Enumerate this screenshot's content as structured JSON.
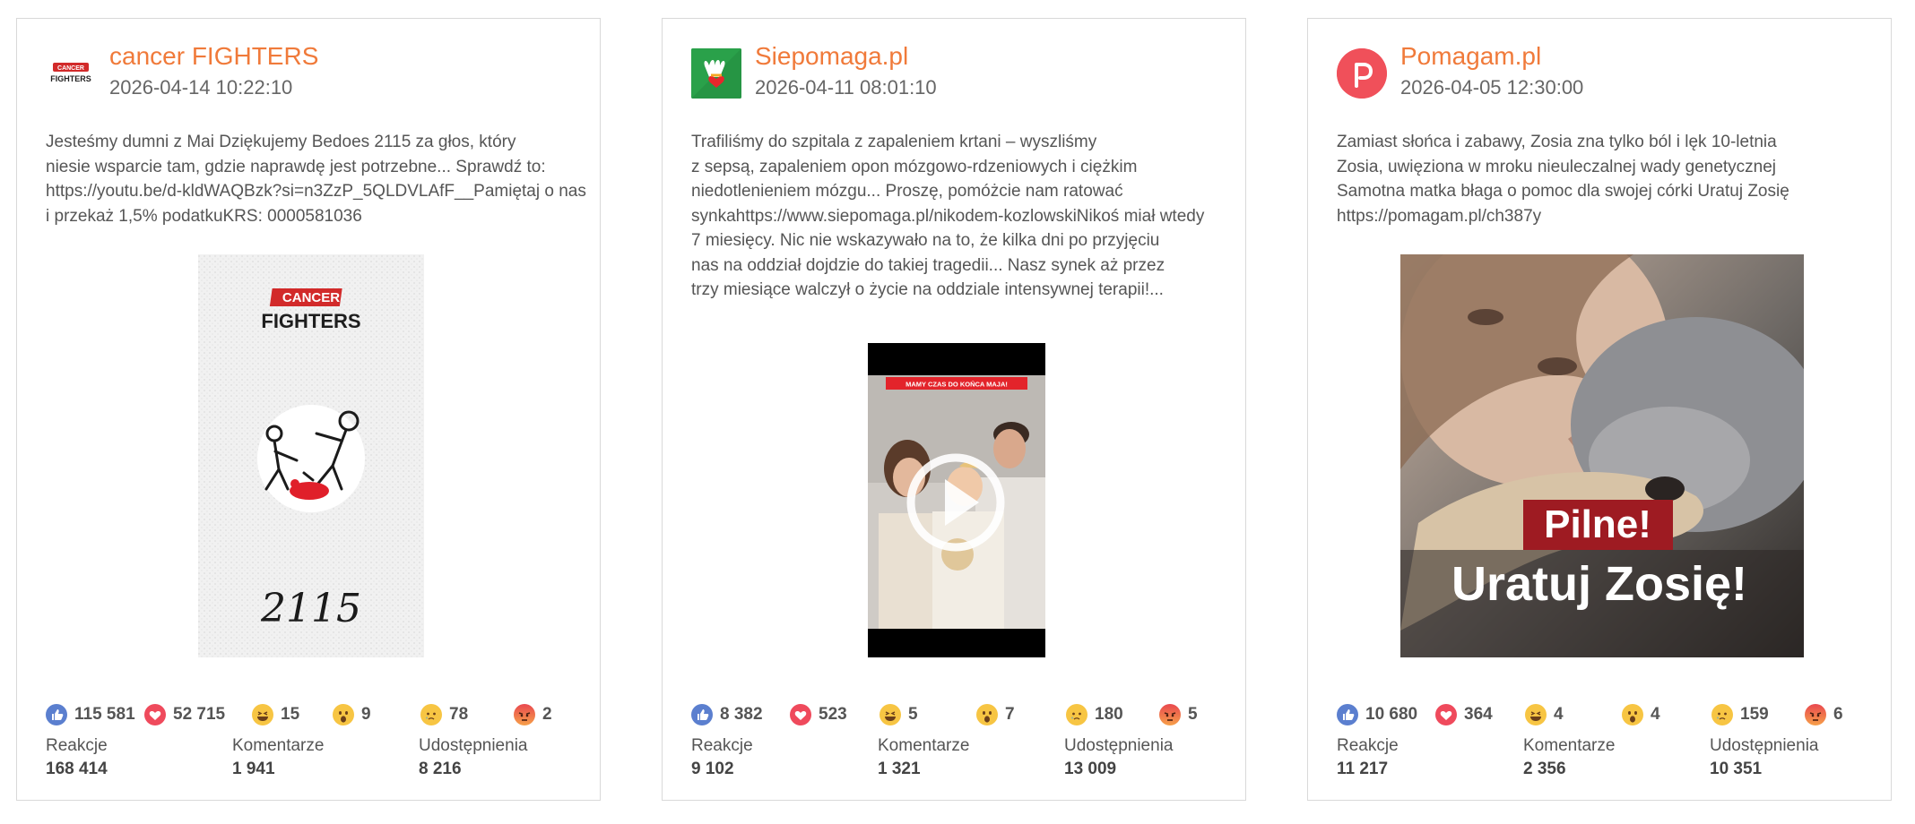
{
  "posts": [
    {
      "page_name": "cancer FIGHTERS",
      "date": "2026-04-14 10:22:10",
      "avatar_text": [
        "CANCER",
        "FIGHTERS"
      ],
      "text_lines": [
        "Jesteśmy dumni z Mai Dziękujemy Bedoes 2115 za głos, który",
        "niesie wsparcie tam, gdzie naprawdę jest potrzebne... Sprawdź to:",
        "https://youtu.be/d-kldWAQBzk?si=n3ZzP_5QLDVLAfF__Pamiętaj o nas",
        "i przekaż 1,5% podatkuKRS: 0000581036"
      ],
      "image_text": {
        "badge": "CANCER",
        "title": "FIGHTERS",
        "number": "2115"
      },
      "reactions": {
        "like": "115 581",
        "love": "52 715",
        "haha": "15",
        "wow": "9",
        "sad": "78",
        "angry": "2"
      },
      "stats": {
        "reactions_label": "Reakcje",
        "reactions": "168 414",
        "comments_label": "Komentarze",
        "comments": "1 941",
        "shares_label": "Udostępnienia",
        "shares": "8 216"
      }
    },
    {
      "page_name": "Siepomaga.pl",
      "date": "2026-04-11 08:01:10",
      "text_lines": [
        "Trafiliśmy do szpitala z zapaleniem krtani – wyszliśmy",
        "z sepsą, zapaleniem opon mózgowo-rdzeniowych i ciężkim",
        "niedotlenieniem mózgu... Proszę, pomóżcie nam ratować",
        "synkahttps://www.siepomaga.pl/nikodem-kozlowskiNikoś miał wtedy",
        "7 miesięcy. Nic nie wskazywało na to, że kilka dni po przyjęciu",
        "nas na oddział dojdzie do takiej tragedii... Nasz synek aż przez",
        "trzy miesiące walczył o życie na oddziale intensywnej terapii!..."
      ],
      "video_banner": "MAMY CZAS DO KOŃCA MAJA!",
      "reactions": {
        "like": "8 382",
        "love": "523",
        "haha": "5",
        "wow": "7",
        "sad": "180",
        "angry": "5"
      },
      "stats": {
        "reactions_label": "Reakcje",
        "reactions": "9 102",
        "comments_label": "Komentarze",
        "comments": "1 321",
        "shares_label": "Udostępnienia",
        "shares": "13 009"
      }
    },
    {
      "page_name": "Pomagam.pl",
      "date": "2026-04-05 12:30:00",
      "text_lines": [
        "Zamiast słońca i zabawy, Zosia zna tylko ból i lęk 10-letnia",
        "Zosia, uwięziona w mroku nieuleczalnej wady genetycznej",
        "Samotna matka błaga o pomoc dla swojej córki Uratuj Zosię",
        "https://pomagam.pl/ch387y"
      ],
      "image_text": {
        "badge": "Pilne!",
        "headline": "Uratuj Zosię!"
      },
      "reactions": {
        "like": "10 680",
        "love": "364",
        "haha": "4",
        "wow": "4",
        "sad": "159",
        "angry": "6"
      },
      "stats": {
        "reactions_label": "Reakcje",
        "reactions": "11 217",
        "comments_label": "Komentarze",
        "comments": "2 356",
        "shares_label": "Udostępnienia",
        "shares": "10 351"
      }
    }
  ],
  "colors": {
    "accent": "#f07a3a",
    "border": "#d9d9d9",
    "like": "#5b7fcf",
    "love": "#ef4a5c",
    "emoji": "#f7c543"
  },
  "icons": [
    "like-icon",
    "love-icon",
    "haha-icon",
    "wow-icon",
    "sad-icon",
    "angry-icon",
    "play-icon"
  ]
}
